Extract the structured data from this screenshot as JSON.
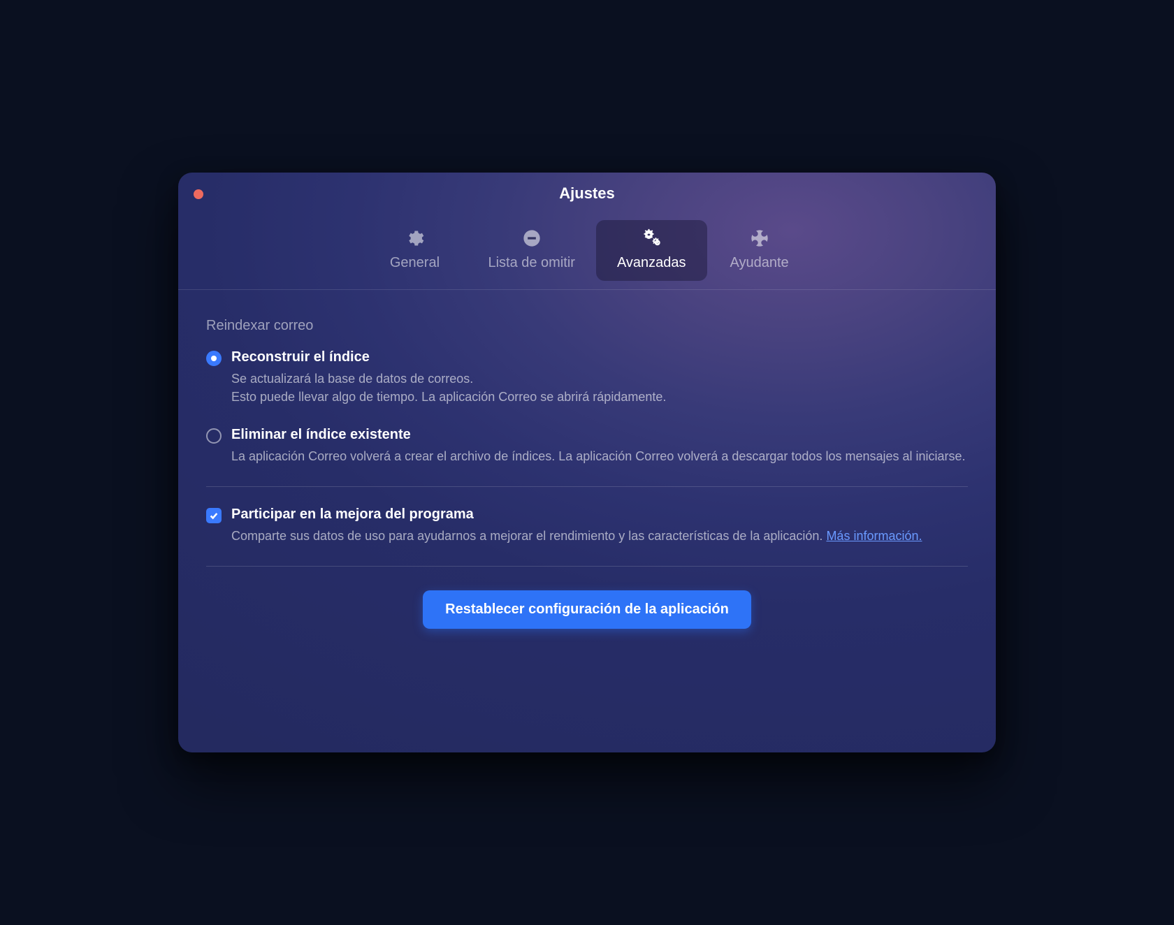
{
  "window": {
    "title": "Ajustes"
  },
  "tabs": [
    {
      "label": "General"
    },
    {
      "label": "Lista de omitir"
    },
    {
      "label": "Avanzadas"
    },
    {
      "label": "Ayudante"
    }
  ],
  "section": {
    "heading": "Reindexar correo",
    "options": [
      {
        "title": "Reconstruir el índice",
        "desc_line1": "Se actualizará la base de datos de correos.",
        "desc_line2": "Esto puede llevar algo de tiempo. La aplicación Correo se abrirá rápidamente.",
        "selected": true
      },
      {
        "title": "Eliminar el índice existente",
        "desc": "La aplicación Correo volverá a crear el archivo de índices. La aplicación Correo volverá a descargar todos los mensajes al iniciarse.",
        "selected": false
      }
    ]
  },
  "improvement": {
    "title": "Participar en la mejora del programa",
    "desc": "Comparte sus datos de uso para ayudarnos a mejorar el rendimiento y las características de la aplicación. ",
    "link": "Más información.",
    "checked": true
  },
  "reset_button": "Restablecer configuración de la aplicación"
}
